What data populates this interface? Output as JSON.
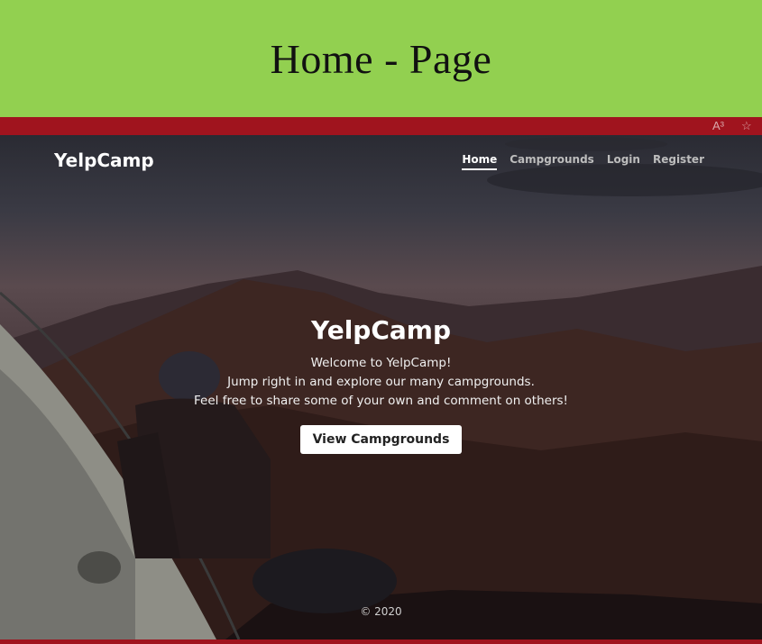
{
  "banner": {
    "title": "Home - Page"
  },
  "browser": {
    "read_aloud_icon": "A³",
    "favorite_icon": "☆"
  },
  "nav": {
    "brand": "YelpCamp",
    "links": [
      {
        "label": "Home",
        "active": true
      },
      {
        "label": "Campgrounds",
        "active": false
      },
      {
        "label": "Login",
        "active": false
      },
      {
        "label": "Register",
        "active": false
      }
    ]
  },
  "hero": {
    "title": "YelpCamp",
    "lines": [
      "Welcome to YelpCamp!",
      "Jump right in and explore our many campgrounds.",
      "Feel free to share some of your own and comment on others!"
    ],
    "button": "View Campgrounds"
  },
  "footer": {
    "text": "© 2020"
  },
  "colors": {
    "banner": "#92d050",
    "frame": "#a0141e"
  }
}
